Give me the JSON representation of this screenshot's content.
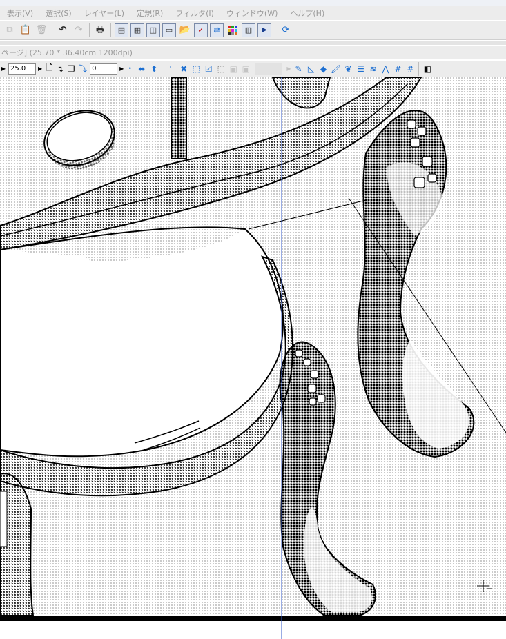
{
  "menu": {
    "items": [
      "表示(V)",
      "選択(S)",
      "レイヤー(L)",
      "定規(R)",
      "フィルタ(I)",
      "ウィンドウ(W)",
      "ヘルプ(H)"
    ]
  },
  "toolbar": {
    "buttons": [
      "copy-icon",
      "paste-icon",
      "delete-icon",
      "undo-icon",
      "redo-icon",
      "print-icon",
      "page-view-icon",
      "page-list-icon",
      "spread-view-icon",
      "window-icon",
      "open-folder-icon",
      "checkbox-icon",
      "convert-icon",
      "color-palette-icon",
      "panel-icon",
      "play-icon",
      "rotate-view-icon"
    ]
  },
  "document": {
    "title": "ページ] (25.70 * 36.40cm 1200dpi)"
  },
  "tool_options": {
    "brush_size": "25.0",
    "angle": "0"
  },
  "colors": {
    "chrome": "#ececec",
    "guide_line": "#3358c8",
    "ink": "#000000"
  }
}
